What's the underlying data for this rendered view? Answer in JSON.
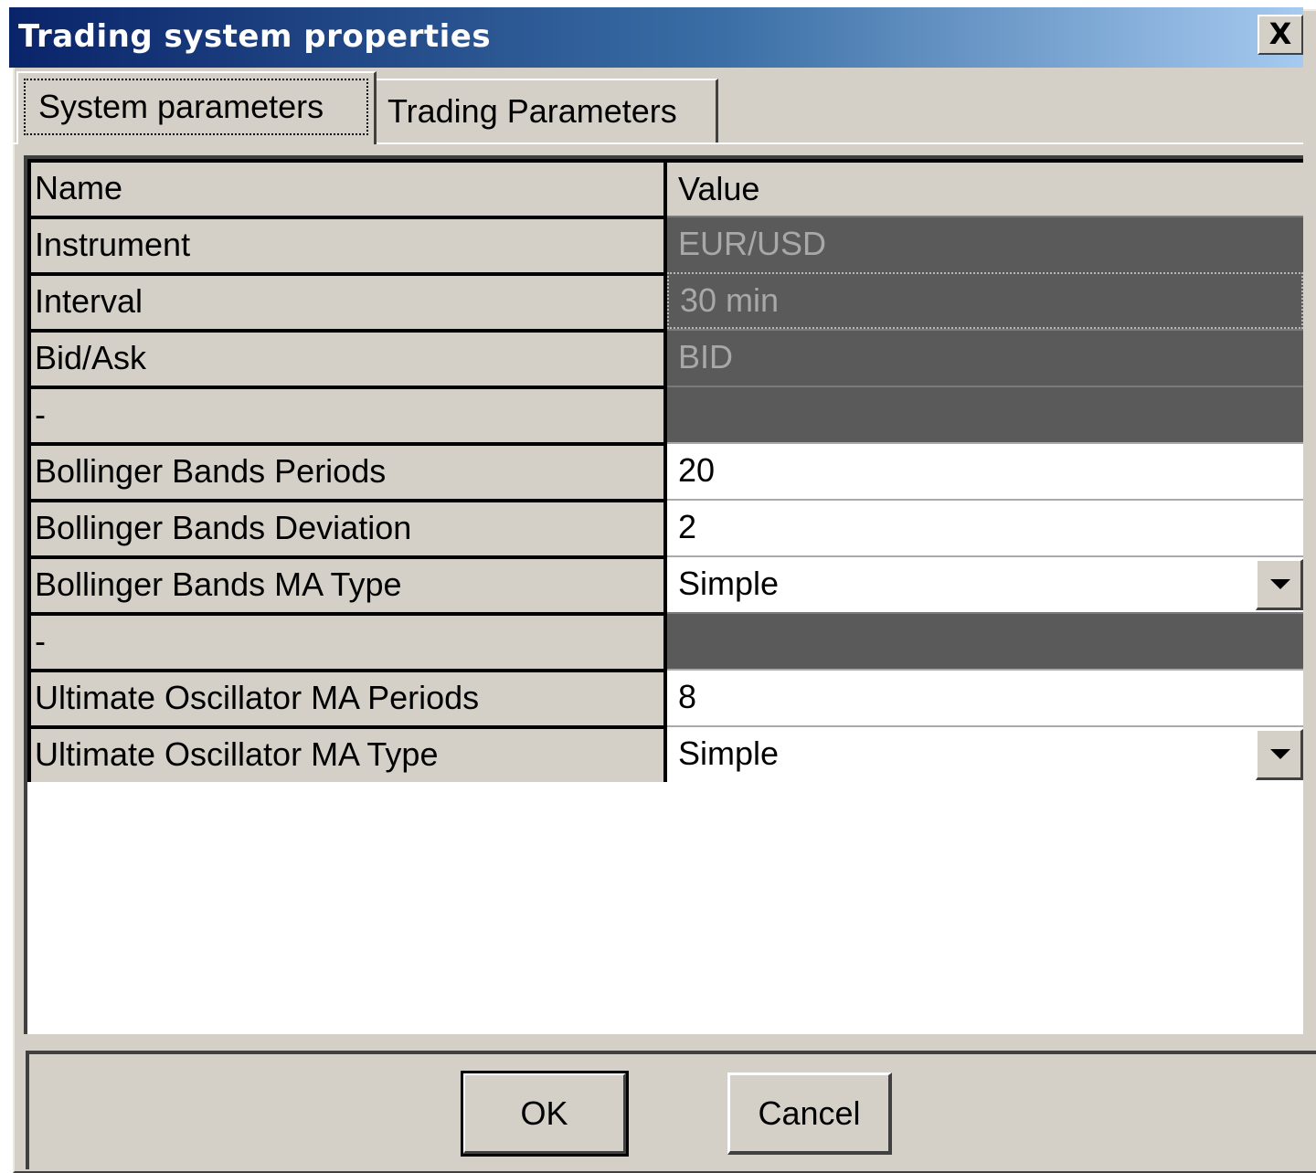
{
  "window": {
    "title": "Trading system properties",
    "close_label": "X"
  },
  "tabs": [
    {
      "label": "System parameters",
      "active": true
    },
    {
      "label": "Trading Parameters",
      "active": false
    }
  ],
  "grid": {
    "columns": [
      "Name",
      "Value"
    ],
    "rows": [
      {
        "name": "Instrument",
        "value": "EUR/USD",
        "state": "disabled"
      },
      {
        "name": "Interval",
        "value": "30 min",
        "state": "disabled-focused"
      },
      {
        "name": "Bid/Ask",
        "value": "BID",
        "state": "disabled"
      },
      {
        "name": "-",
        "value": "",
        "state": "disabled"
      },
      {
        "name": "Bollinger Bands Periods",
        "value": "20",
        "state": "editable"
      },
      {
        "name": "Bollinger Bands Deviation",
        "value": "2",
        "state": "editable"
      },
      {
        "name": "Bollinger Bands MA Type",
        "value": "Simple",
        "state": "dropdown"
      },
      {
        "name": "-",
        "value": "",
        "state": "disabled"
      },
      {
        "name": "Ultimate Oscillator MA Periods",
        "value": "8",
        "state": "editable"
      },
      {
        "name": "Ultimate Oscillator MA Type",
        "value": "Simple",
        "state": "dropdown"
      }
    ]
  },
  "buttons": {
    "ok_label": "OK",
    "cancel_label": "Cancel"
  },
  "colors": {
    "title_gradient_start": "#0a246a",
    "title_gradient_end": "#a6caf0",
    "face": "#d4d0c8",
    "disabled_cell": "#5a5a5a",
    "disabled_text": "#a8a8a8"
  }
}
